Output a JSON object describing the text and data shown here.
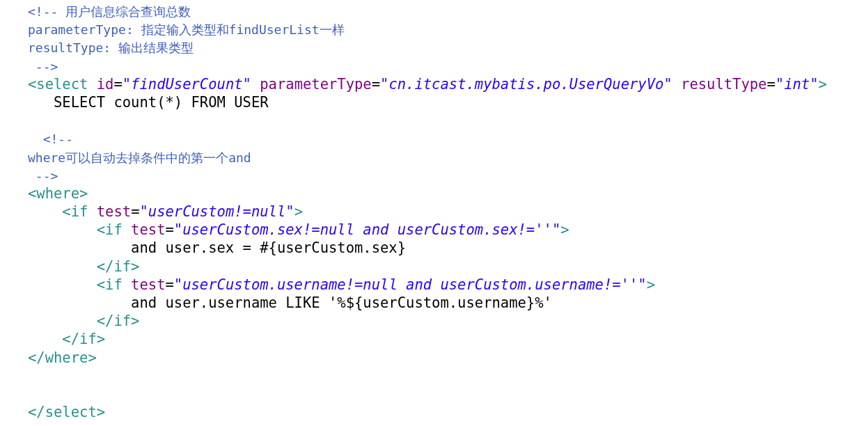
{
  "editor": {
    "lines": [
      {
        "kind": "code",
        "tokens": [
          {
            "kind": "comment",
            "text": "<!-- 用户信息综合查询总数"
          }
        ]
      },
      {
        "kind": "code",
        "tokens": [
          {
            "kind": "comment",
            "text": "parameterType: 指定输入类型和findUserList一样"
          }
        ]
      },
      {
        "kind": "code",
        "tokens": [
          {
            "kind": "comment",
            "text": "resultType: 输出结果类型"
          }
        ]
      },
      {
        "kind": "code",
        "tokens": [
          {
            "kind": "comment",
            "text": " -->"
          }
        ]
      },
      {
        "kind": "code",
        "tokens": [
          {
            "kind": "tag",
            "text": "<select"
          },
          {
            "kind": "attr",
            "text": " id"
          },
          {
            "kind": "text",
            "text": "="
          },
          {
            "kind": "value",
            "text": "\"findUserCount\""
          },
          {
            "kind": "attr",
            "text": " parameterType"
          },
          {
            "kind": "text",
            "text": "="
          },
          {
            "kind": "value",
            "text": "\"cn.itcast.mybatis.po.UserQueryVo\""
          },
          {
            "kind": "attr",
            "text": " resultType"
          },
          {
            "kind": "text",
            "text": "="
          },
          {
            "kind": "value",
            "text": "\"int\""
          },
          {
            "kind": "tag",
            "text": ">"
          }
        ]
      },
      {
        "kind": "code",
        "tokens": [
          {
            "kind": "text",
            "text": "   SELECT count(*) FROM USER"
          }
        ]
      },
      {
        "kind": "blank"
      },
      {
        "kind": "code",
        "tokens": [
          {
            "kind": "comment",
            "text": "  <!--"
          }
        ]
      },
      {
        "kind": "code",
        "tokens": [
          {
            "kind": "comment",
            "text": "where可以自动去掉条件中的第一个and"
          }
        ]
      },
      {
        "kind": "code",
        "tokens": [
          {
            "kind": "comment",
            "text": " -->"
          }
        ]
      },
      {
        "kind": "code",
        "tokens": [
          {
            "kind": "tag",
            "text": "<where>"
          }
        ]
      },
      {
        "kind": "code",
        "tokens": [
          {
            "kind": "tag",
            "text": "    <if"
          },
          {
            "kind": "attr",
            "text": " test"
          },
          {
            "kind": "text",
            "text": "="
          },
          {
            "kind": "value",
            "text": "\"userCustom!=null\""
          },
          {
            "kind": "tag",
            "text": ">"
          }
        ]
      },
      {
        "kind": "code",
        "tokens": [
          {
            "kind": "tag",
            "text": "        <if"
          },
          {
            "kind": "attr",
            "text": " test"
          },
          {
            "kind": "text",
            "text": "="
          },
          {
            "kind": "value",
            "text": "\"userCustom.sex!=null and userCustom.sex!=''\""
          },
          {
            "kind": "tag",
            "text": ">"
          }
        ]
      },
      {
        "kind": "code",
        "tokens": [
          {
            "kind": "text",
            "text": "            and user.sex = #{userCustom.sex}"
          }
        ]
      },
      {
        "kind": "code",
        "tokens": [
          {
            "kind": "tag",
            "text": "        </if>"
          }
        ]
      },
      {
        "kind": "code",
        "tokens": [
          {
            "kind": "tag",
            "text": "        <if"
          },
          {
            "kind": "attr",
            "text": " test"
          },
          {
            "kind": "text",
            "text": "="
          },
          {
            "kind": "value",
            "text": "\"userCustom.username!=null and userCustom.username!=''\""
          },
          {
            "kind": "tag",
            "text": ">"
          }
        ]
      },
      {
        "kind": "code",
        "tokens": [
          {
            "kind": "text",
            "text": "            and user.username LIKE '%${userCustom.username}%'"
          }
        ]
      },
      {
        "kind": "code",
        "tokens": [
          {
            "kind": "tag",
            "text": "        </if>"
          }
        ]
      },
      {
        "kind": "code",
        "tokens": [
          {
            "kind": "tag",
            "text": "    </if>"
          }
        ]
      },
      {
        "kind": "code",
        "tokens": [
          {
            "kind": "tag",
            "text": "</where>"
          }
        ]
      },
      {
        "kind": "blank"
      },
      {
        "kind": "blank"
      },
      {
        "kind": "code",
        "tokens": [
          {
            "kind": "tag",
            "text": "</select>"
          }
        ]
      }
    ]
  }
}
